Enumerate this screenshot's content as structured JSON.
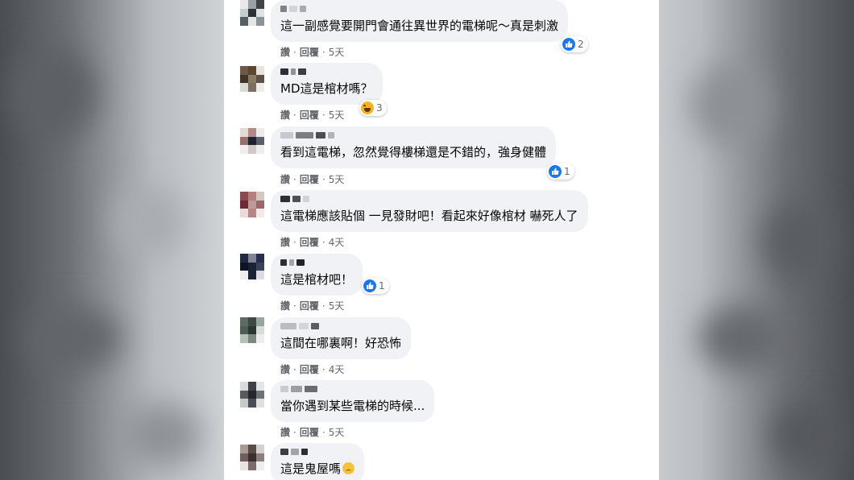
{
  "comments": [
    {
      "text": "這一副感覺要開門會通往異世界的電梯呢～真是刺激",
      "reaction": {
        "type": "like",
        "count": "2"
      },
      "actions": {
        "like": "讚",
        "reply": "回覆",
        "time": "5天"
      }
    },
    {
      "text": "MD這是棺材嗎？",
      "reaction": {
        "type": "haha",
        "count": "3"
      },
      "actions": {
        "like": "讚",
        "reply": "回覆",
        "time": "5天"
      }
    },
    {
      "text": "看到這電梯，忽然覺得樓梯還是不錯的，強身健體",
      "reaction": {
        "type": "like",
        "count": "1"
      },
      "actions": {
        "like": "讚",
        "reply": "回覆",
        "time": "5天"
      }
    },
    {
      "text": "這電梯應該貼個 一見發財吧！看起來好像棺材 嚇死人了",
      "reaction": null,
      "actions": {
        "like": "讚",
        "reply": "回覆",
        "time": "4天"
      }
    },
    {
      "text": "這是棺材吧！",
      "reaction": {
        "type": "like",
        "count": "1"
      },
      "actions": {
        "like": "讚",
        "reply": "回覆",
        "time": "5天"
      }
    },
    {
      "text": "這間在哪裏啊！好恐怖",
      "reaction": null,
      "actions": {
        "like": "讚",
        "reply": "回覆",
        "time": "4天"
      }
    },
    {
      "text": "當你遇到某些電梯的時候...",
      "reaction": null,
      "actions": {
        "like": "讚",
        "reply": "回覆",
        "time": "5天"
      }
    },
    {
      "text": "這是鬼屋嗎",
      "reaction": null,
      "actions": null
    }
  ],
  "separator": "·",
  "colors": {
    "like_blue": "#1877f2",
    "bubble_bg": "#f0f2f5",
    "meta_gray": "#65676b"
  }
}
